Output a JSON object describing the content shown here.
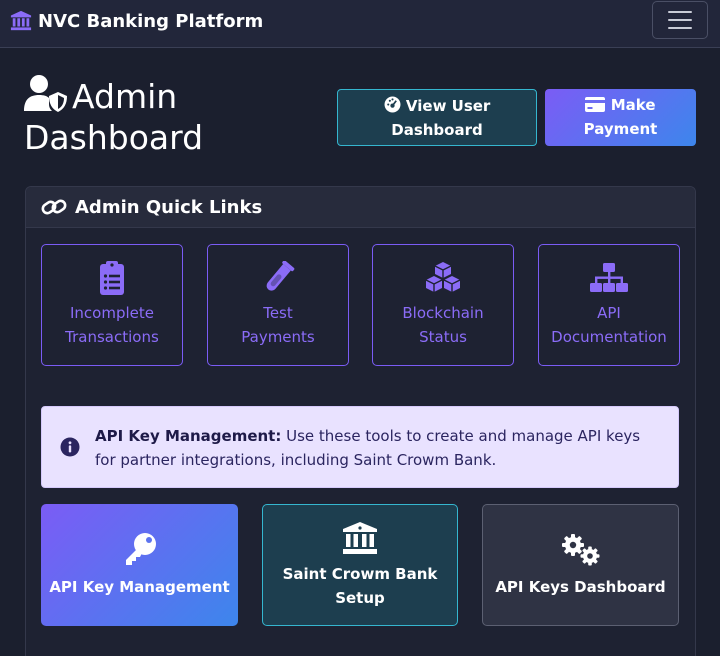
{
  "navbar": {
    "brand": "NVC Banking Platform",
    "brand_icon": "bank-icon",
    "menu_icon": "hamburger-menu-icon"
  },
  "header": {
    "title_line1": "Admin",
    "title_line2": "Dashboard",
    "title_icon": "user-shield-icon",
    "view_user_line1": "View User",
    "view_user_line2": "Dashboard",
    "make_payment_line1": "Make",
    "make_payment_line2": "Payment"
  },
  "quick_links": {
    "title": "Admin Quick Links",
    "items": [
      {
        "line1": "Incomplete",
        "line2": "Transactions",
        "icon": "clipboard-list-icon"
      },
      {
        "line1": "Test",
        "line2": "Payments",
        "icon": "vial-icon"
      },
      {
        "line1": "Blockchain",
        "line2": "Status",
        "icon": "cubes-icon"
      },
      {
        "line1": "API",
        "line2": "Documentation",
        "icon": "sitemap-icon"
      }
    ]
  },
  "alert": {
    "strong": "API Key Management:",
    "text": " Use these tools to create and manage API keys for partner integrations, including Saint Crowm Bank."
  },
  "tiles": [
    {
      "line1": "API Key Management",
      "line2": "",
      "icon": "key-icon"
    },
    {
      "line1": "Saint Crowm Bank",
      "line2": "Setup",
      "icon": "bank-icon"
    },
    {
      "line1": "API Keys Dashboard",
      "line2": "",
      "icon": "gears-icon"
    }
  ],
  "colors": {
    "background": "#1b1f2e",
    "accent_purple": "#7b5cf5",
    "accent_blue": "#3d86ec",
    "accent_teal": "#35b6cf",
    "alert_bg": "#e9e2ff"
  }
}
